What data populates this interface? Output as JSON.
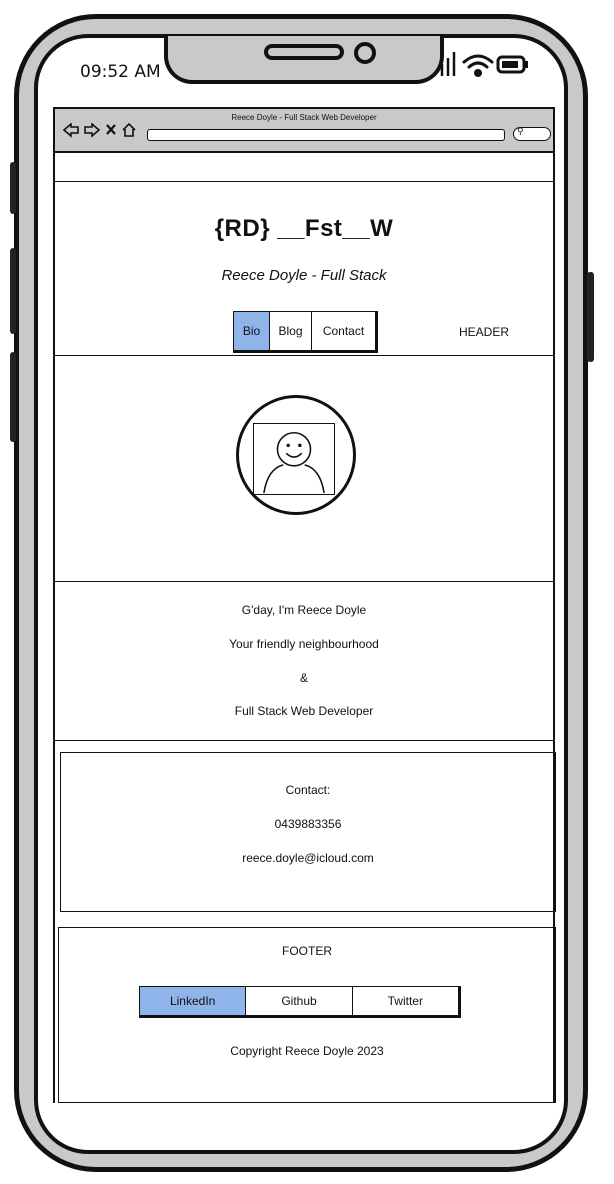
{
  "status_bar": {
    "time": "09:52 AM"
  },
  "browser": {
    "title": "Reece Doyle - Full Stack Web Developer"
  },
  "header": {
    "brand": "{RD} __Fst__W",
    "tagline": "Reece Doyle - Full Stack",
    "nav": [
      "Bio",
      "Blog",
      "Contact"
    ],
    "active_nav": "Bio",
    "label": "HEADER"
  },
  "bio": {
    "lines": [
      "G'day, I'm Reece Doyle",
      "Your friendly neighbourhood",
      "&",
      "Full Stack Web Developer"
    ]
  },
  "contact": {
    "title": "Contact:",
    "phone": "0439883356",
    "email": "reece.doyle@icloud.com"
  },
  "footer": {
    "label": "FOOTER",
    "links": [
      "LinkedIn",
      "Github",
      "Twitter"
    ],
    "active_link": "LinkedIn",
    "copyright": "Copyright Reece Doyle 2023"
  },
  "colors": {
    "accent": "#8fb4ea",
    "device": "#c9c9cb",
    "ink": "#111111"
  },
  "icons": [
    "back-arrow-icon",
    "forward-arrow-icon",
    "close-icon",
    "home-icon",
    "search-icon",
    "signal-icon",
    "wifi-icon",
    "battery-icon",
    "avatar-placeholder-icon"
  ]
}
